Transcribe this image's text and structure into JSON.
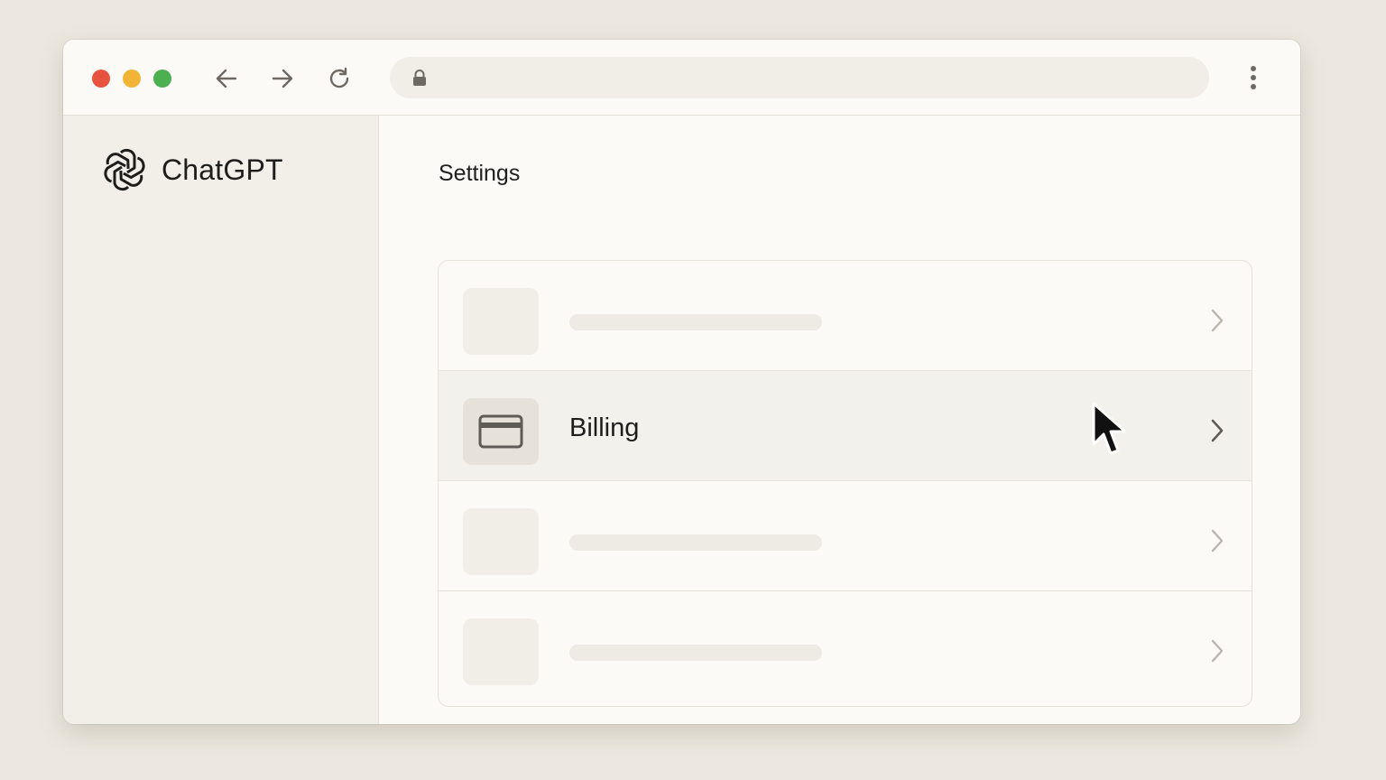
{
  "browser": {
    "window_controls": [
      {
        "name": "close",
        "color": "#e8533f"
      },
      {
        "name": "minimize",
        "color": "#f2b437"
      },
      {
        "name": "maximize",
        "color": "#4caf50"
      }
    ],
    "icons": {
      "back": "arrow-left-icon",
      "forward": "arrow-right-icon",
      "reload": "reload-icon",
      "lock": "lock-icon",
      "menu": "more-vertical-icon"
    }
  },
  "sidebar": {
    "brand": "ChatGPT",
    "logo_icon": "openai-logo-icon"
  },
  "main": {
    "title": "Settings",
    "rows": [
      {
        "label": "",
        "placeholder": true
      },
      {
        "label": "Billing",
        "icon": "credit-card-icon",
        "selected": true
      },
      {
        "label": "",
        "placeholder": true
      },
      {
        "label": "",
        "placeholder": true
      }
    ]
  },
  "colors": {
    "background": "#ece8df",
    "window": "#fbfaf7",
    "sidebar": "#f2efe9",
    "selected_row": "#f3f1ec"
  }
}
